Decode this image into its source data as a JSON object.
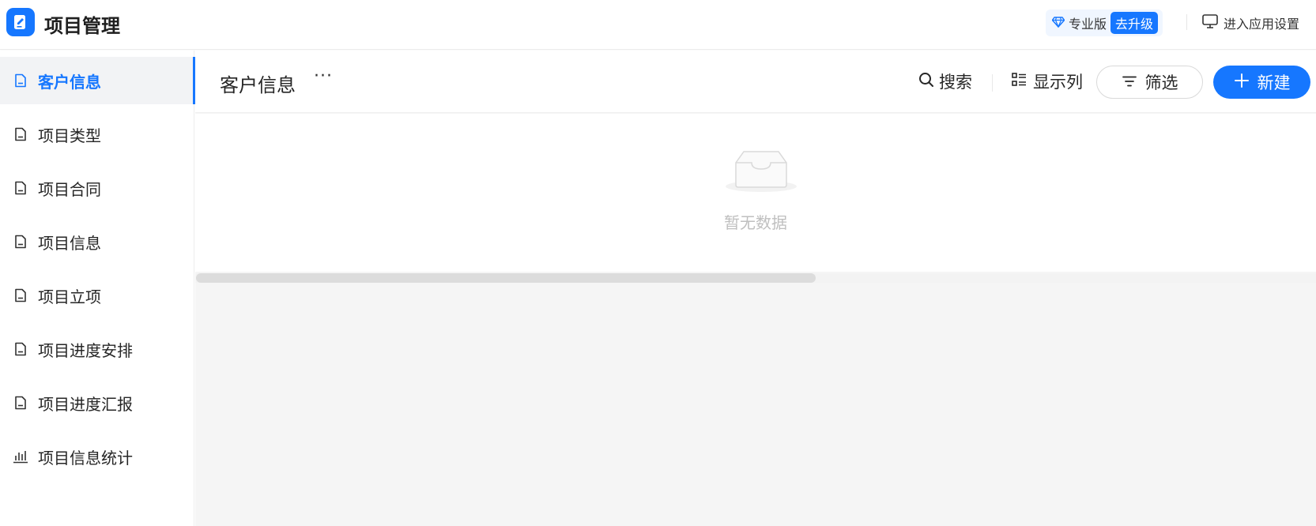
{
  "app": {
    "title": "项目管理"
  },
  "header": {
    "plan_label": "专业版",
    "upgrade_label": "去升级",
    "settings_label": "进入应用设置"
  },
  "sidebar": {
    "items": [
      {
        "label": "客户信息",
        "icon": "document-icon",
        "active": true
      },
      {
        "label": "项目类型",
        "icon": "document-icon",
        "active": false
      },
      {
        "label": "项目合同",
        "icon": "document-icon",
        "active": false
      },
      {
        "label": "项目信息",
        "icon": "document-icon",
        "active": false
      },
      {
        "label": "项目立项",
        "icon": "document-icon",
        "active": false
      },
      {
        "label": "项目进度安排",
        "icon": "document-icon",
        "active": false
      },
      {
        "label": "项目进度汇报",
        "icon": "document-icon",
        "active": false
      },
      {
        "label": "项目信息统计",
        "icon": "bar-chart-icon",
        "active": false
      }
    ]
  },
  "main": {
    "title": "客户信息",
    "more_label": "···",
    "search_label": "搜索",
    "columns_label": "显示列",
    "filter_label": "筛选",
    "new_label": "新建",
    "empty_text": "暂无数据"
  },
  "colors": {
    "accent": "#1677ff",
    "active_bg": "#f2f3f5",
    "muted_text": "#bfbfbf"
  }
}
